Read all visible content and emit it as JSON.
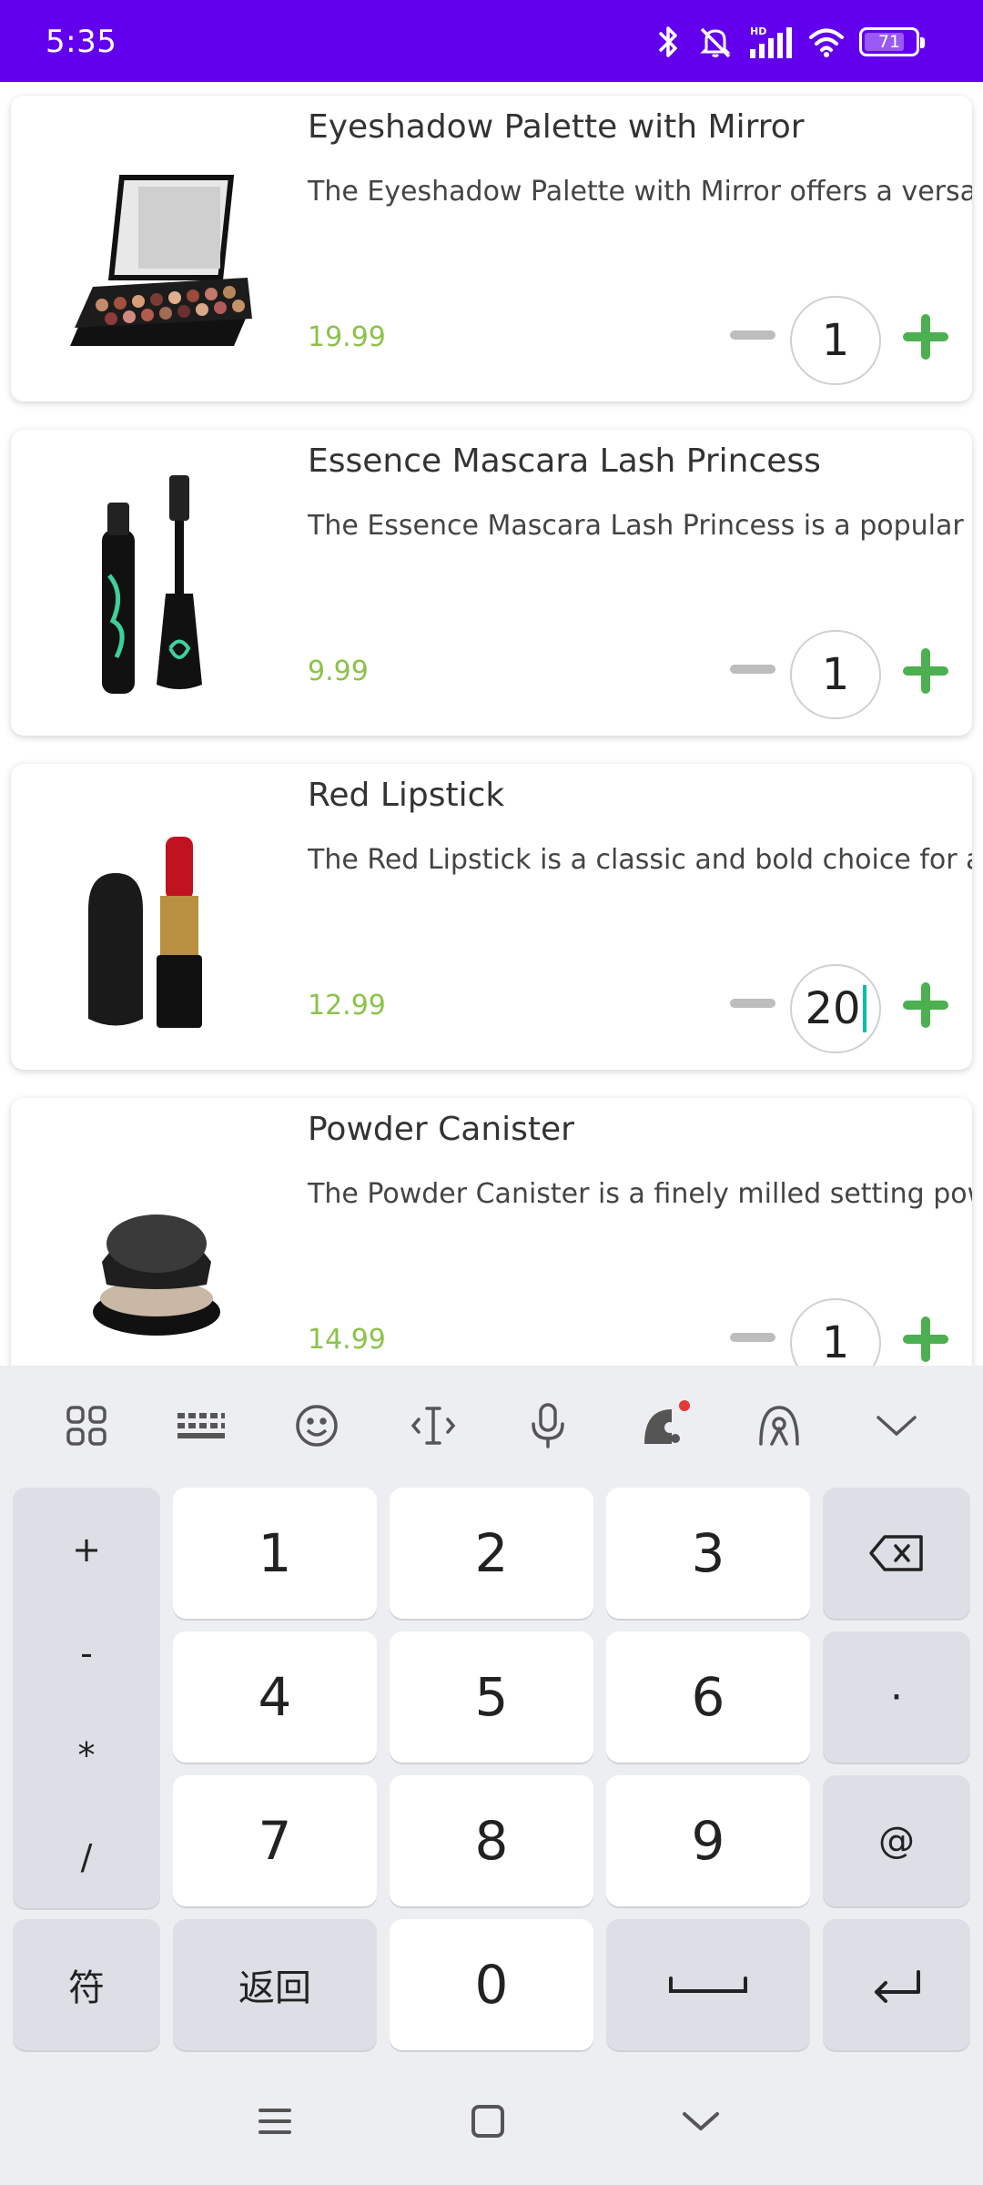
{
  "status_bar": {
    "time": "5:35",
    "battery_level": "71",
    "icons": [
      "bluetooth-icon",
      "mute-icon",
      "hd-signal-icon",
      "wifi-icon",
      "battery-icon"
    ],
    "background_color": "#6200EE"
  },
  "products": [
    {
      "title": "Eyeshadow Palette with Mirror",
      "description": "The Eyeshadow Palette with Mirror offers a versatile range of eyeshadow shades",
      "price": "19.99",
      "quantity": "1"
    },
    {
      "title": "Essence Mascara Lash Princess",
      "description": "The Essence Mascara Lash Princess is a popular mascara known for its volumizing",
      "price": "9.99",
      "quantity": "1"
    },
    {
      "title": "Red Lipstick",
      "description": "The Red Lipstick is a classic and bold choice for adding a pop of color",
      "price": "12.99",
      "quantity": "20"
    },
    {
      "title": "Powder Canister",
      "description": "The Powder Canister is a finely milled setting powder designed to set makeup",
      "price": "14.99",
      "quantity": "1"
    }
  ],
  "colors": {
    "price": "#8BC34A",
    "plus": "#4CAF50",
    "minus": "#BDBDBD",
    "cursor": "#00BFA5"
  },
  "keyboard": {
    "symbols": [
      "+",
      "-",
      "*",
      "/"
    ],
    "digits": [
      "1",
      "2",
      "3",
      "4",
      "5",
      "6",
      "7",
      "8",
      "9",
      "0"
    ],
    "dot": "·",
    "at": "@",
    "symbols_key": "符",
    "back_key": "返回",
    "toolbar_icons": [
      "apps-grid-icon",
      "keyboard-icon",
      "emoji-icon",
      "text-cursor-icon",
      "microphone-icon",
      "theme-icon",
      "handwriting-icon",
      "collapse-keyboard-icon"
    ]
  },
  "nav_bar": {
    "icons": [
      "menu-icon",
      "home-icon",
      "back-icon"
    ]
  }
}
